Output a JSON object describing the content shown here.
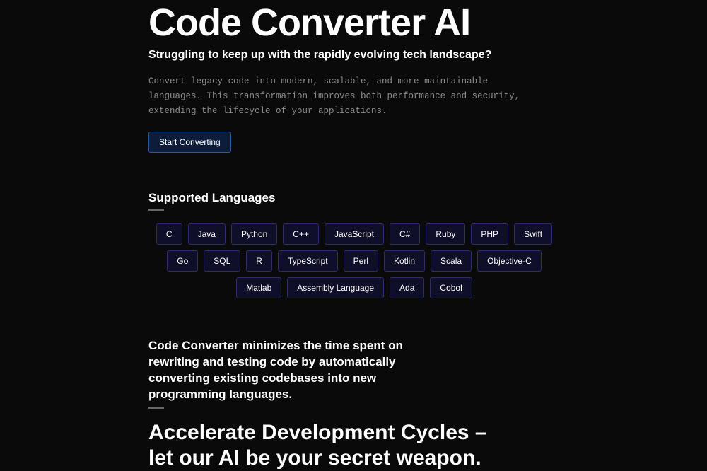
{
  "hero": {
    "title": "Code Converter AI",
    "subtitle": "Struggling to keep up with the rapidly evolving tech landscape?",
    "description": "Convert legacy code into modern, scalable, and more maintainable languages. This transformation improves both performance and security, extending the lifecycle of your applications.",
    "cta_label": "Start Converting"
  },
  "languages": {
    "heading": "Supported Languages",
    "items": [
      "C",
      "Java",
      "Python",
      "C++",
      "JavaScript",
      "C#",
      "Ruby",
      "PHP",
      "Swift",
      "Go",
      "SQL",
      "R",
      "TypeScript",
      "Perl",
      "Kotlin",
      "Scala",
      "Objective-C",
      "Matlab",
      "Assembly Language",
      "Ada",
      "Cobol"
    ]
  },
  "benefit": {
    "heading": "Code Converter minimizes the time spent on rewriting and testing code by automatically converting existing codebases into new programming languages.",
    "headline_line1": "Accelerate Development Cycles –",
    "headline_line2": "let our AI be your secret weapon."
  }
}
